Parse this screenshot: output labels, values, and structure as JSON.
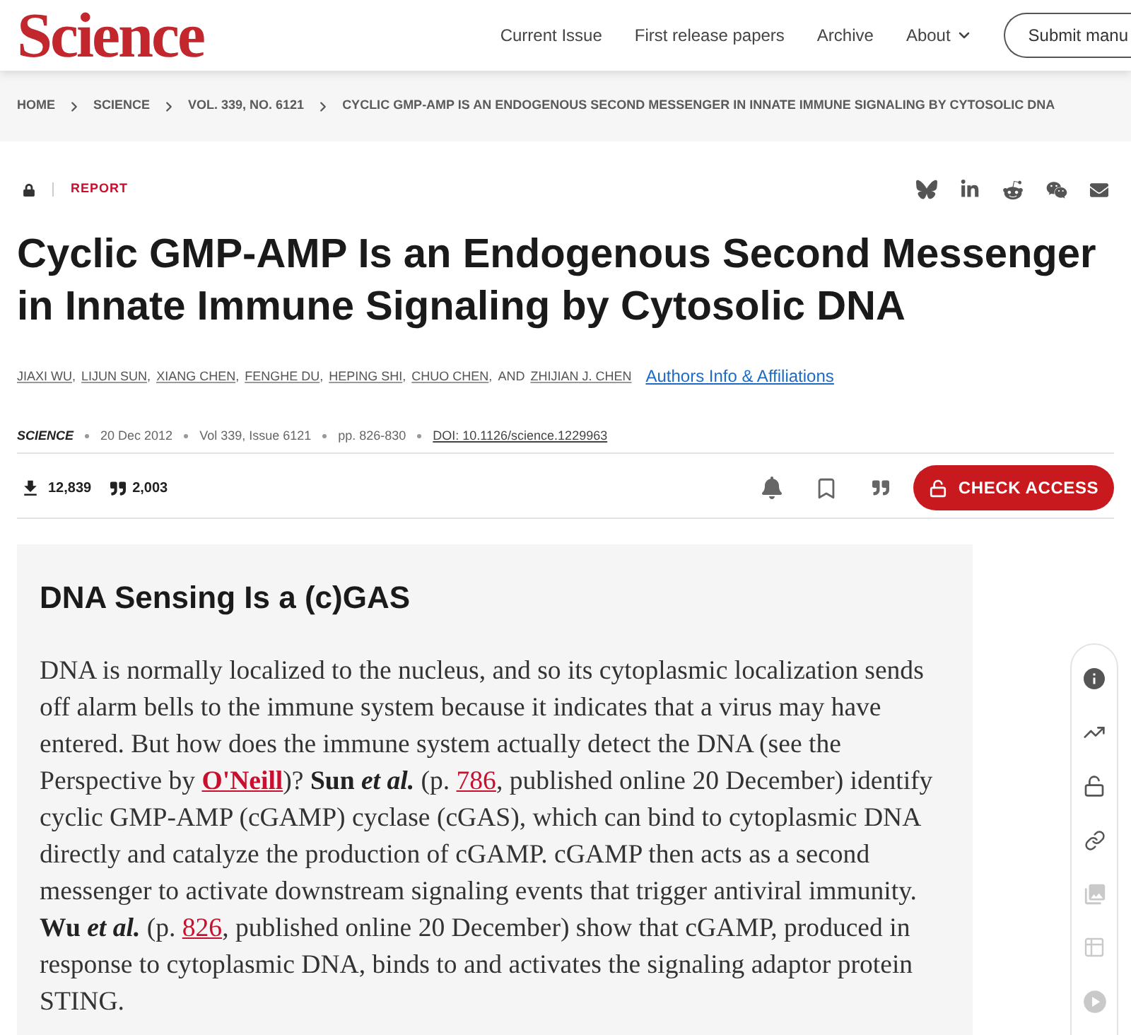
{
  "header": {
    "logo": "Science",
    "nav": [
      {
        "label": "Current Issue",
        "has_menu": false
      },
      {
        "label": "First release papers",
        "has_menu": false
      },
      {
        "label": "Archive",
        "has_menu": false
      },
      {
        "label": "About",
        "has_menu": true
      }
    ],
    "submit_button": "Submit manu"
  },
  "breadcrumb": [
    "HOME",
    "SCIENCE",
    "VOL. 339, NO. 6121",
    "CYCLIC GMP-AMP IS AN ENDOGENOUS SECOND MESSENGER IN INNATE IMMUNE SIGNALING BY CYTOSOLIC DNA"
  ],
  "article": {
    "type": "REPORT",
    "title": "Cyclic GMP-AMP Is an Endogenous Second Messenger in Innate Immune Signaling by Cytosolic DNA",
    "authors": [
      {
        "name": "JIAXI WU",
        "separator": ","
      },
      {
        "name": "LIJUN SUN",
        "separator": ","
      },
      {
        "name": "XIANG CHEN",
        "separator": ","
      },
      {
        "name": "FENGHE DU",
        "separator": ","
      },
      {
        "name": "HEPING SHI",
        "separator": ","
      },
      {
        "name": "CHUO CHEN",
        "separator": ","
      },
      {
        "name": "ZHIJIAN J. CHEN"
      }
    ],
    "authors_conjunction": "AND",
    "authors_info_link": "Authors Info & Affiliations",
    "meta": {
      "journal": "SCIENCE",
      "date": "20 Dec 2012",
      "issue": "Vol 339, Issue 6121",
      "pages": "pp. 826-830",
      "doi": "DOI: 10.1126/science.1229963"
    },
    "metrics": {
      "downloads": "12,839",
      "citations": "2,003"
    },
    "check_access_button": "CHECK ACCESS"
  },
  "summary": {
    "title": "DNA Sensing Is a (c)GAS",
    "body": [
      {
        "kind": "text",
        "text": "DNA is normally localized to the nucleus, and so its cytoplasmic localization sends off alarm bells to the immune system because it indicates that a virus may have entered. But how does the immune system actually detect the DNA (see the Perspective by "
      },
      {
        "kind": "link",
        "text": "O'Neill",
        "bold": true
      },
      {
        "kind": "text",
        "text": ")? "
      },
      {
        "kind": "emphasis",
        "text": "Sun *et al.*"
      },
      {
        "kind": "text",
        "text": " (p. "
      },
      {
        "kind": "link",
        "text": "786",
        "bold": false
      },
      {
        "kind": "text",
        "text": ", published online 20 December) identify cyclic GMP-AMP (cGAMP) cyclase (cGAS), which can bind to cytoplasmic DNA directly and catalyze the production of cGAMP. cGAMP then acts as a second messenger to activate downstream signaling events that trigger antiviral immunity. "
      },
      {
        "kind": "emphasis",
        "text": "Wu *et al.*"
      },
      {
        "kind": "text",
        "text": " (p. "
      },
      {
        "kind": "link",
        "text": "826",
        "bold": false
      },
      {
        "kind": "text",
        "text": ", published online 20 December) show that cGAMP, produced in response to cytoplasmic DNA, binds to and activates the signaling adaptor protein STING."
      }
    ]
  },
  "side_rail": [
    {
      "disabled": false
    },
    {
      "disabled": false
    },
    {
      "disabled": false
    },
    {
      "disabled": false
    },
    {
      "disabled": true
    },
    {
      "disabled": true
    },
    {
      "disabled": true
    }
  ]
}
